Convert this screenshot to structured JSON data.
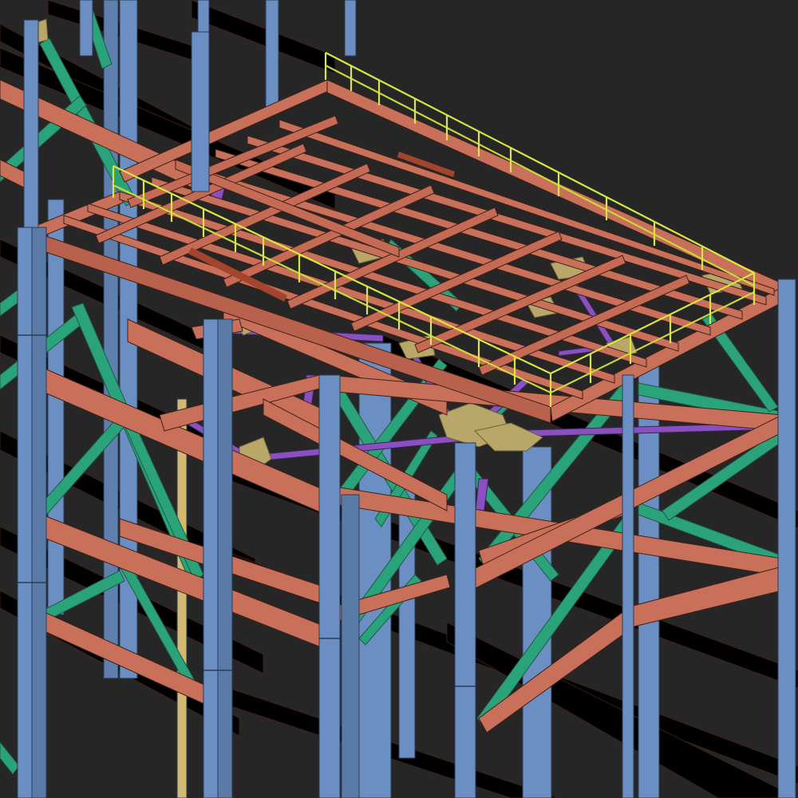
{
  "view": {
    "type": "3d-steel-structure-model",
    "background": "#262626"
  },
  "colors": {
    "column": "#6b8fc2",
    "beam": "#c9705a",
    "bracing": "#2aa37a",
    "secondary_bracing": "#8a4fc0",
    "handrail": "#d7e640",
    "gusset_plate": "#b8a768",
    "post": "#d4b870"
  },
  "legend_names": {
    "column": "column-icon",
    "beam": "beam-icon",
    "bracing": "bracing-icon",
    "handrail": "handrail-icon"
  }
}
